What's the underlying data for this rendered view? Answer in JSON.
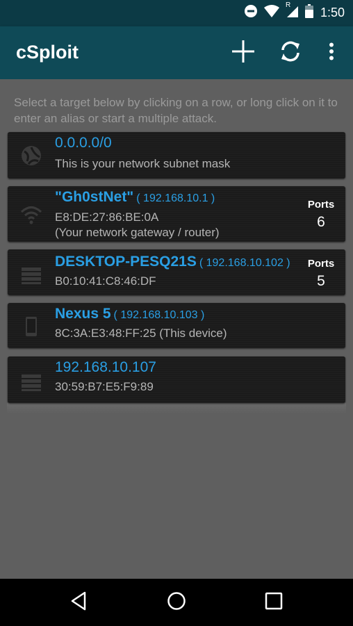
{
  "status_bar": {
    "time": "1:50",
    "roaming_indicator": "R",
    "icons": [
      "do-not-disturb-icon",
      "wifi-icon",
      "cell-signal-icon",
      "battery-icon"
    ]
  },
  "app_bar": {
    "title": "cSploit",
    "actions": [
      "add-icon",
      "refresh-icon",
      "overflow-menu-icon"
    ]
  },
  "hint": "Select a target below by clicking on a row, or long click on it to enter an alias or start a multiple attack.",
  "targets": [
    {
      "icon": "network-icon",
      "name": "0.0.0.0/0",
      "ip": "",
      "lines": [
        "This is your network subnet mask"
      ]
    },
    {
      "icon": "wifi-router-icon",
      "name": "\"Gh0stNet\"",
      "ip": "( 192.168.10.1 )",
      "lines": [
        "E8:DE:27:86:BE:0A",
        "(Your network gateway / router)"
      ],
      "ports_label": "Ports",
      "ports_count": "6"
    },
    {
      "icon": "computer-icon",
      "name": "DESKTOP-PESQ21S",
      "ip": "( 192.168.10.102 )",
      "lines": [
        "B0:10:41:C8:46:DF"
      ],
      "ports_label": "Ports",
      "ports_count": "5"
    },
    {
      "icon": "phone-icon",
      "name": "Nexus 5",
      "ip": "( 192.168.10.103 )",
      "lines": [
        "8C:3A:E3:48:FF:25 (This device)"
      ]
    },
    {
      "icon": "computer-icon",
      "name": "192.168.10.107",
      "ip": "",
      "lines": [
        "30:59:B7:E5:F9:89"
      ]
    }
  ],
  "nav_bar": {
    "buttons": [
      "back-icon",
      "home-icon",
      "recents-icon"
    ]
  },
  "colors": {
    "app_bar": "#0f4a57",
    "status_bar": "#0c3a45",
    "accent_text": "#2a9fe4",
    "row_bg": "#1b1b1b",
    "page_bg": "#5f5f5f"
  }
}
